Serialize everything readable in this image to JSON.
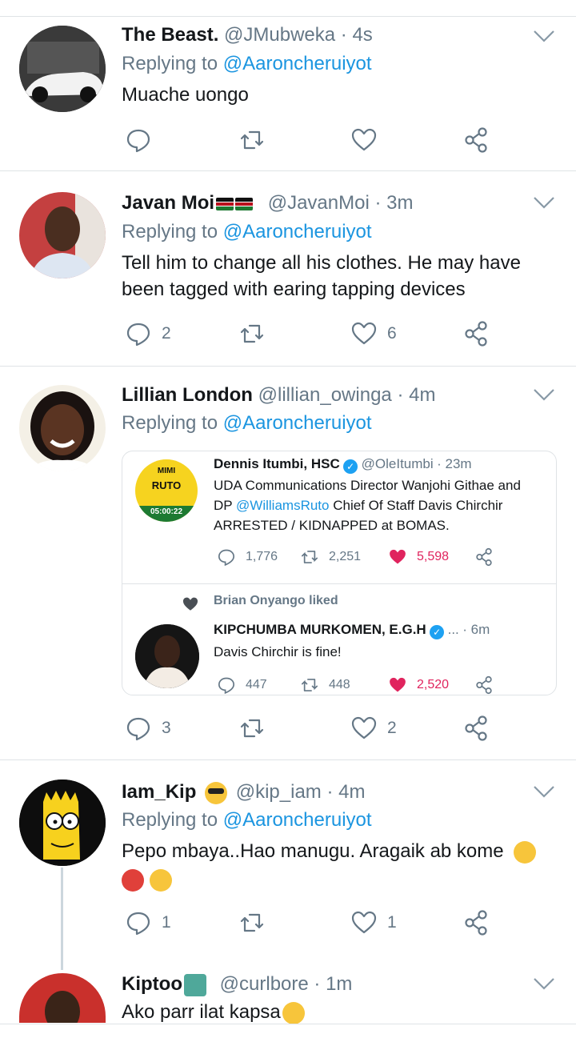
{
  "tweets": [
    {
      "name": "The Beast.",
      "handle": "@JMubweka",
      "time": "· 4s",
      "replying_prefix": "Replying to ",
      "replying_to": "@Aaroncheruiyot",
      "text": "Muache uongo",
      "replies": "",
      "likes": ""
    },
    {
      "name": "Javan Moi",
      "handle": "@JavanMoi",
      "time": "· 3m",
      "replying_prefix": "Replying to ",
      "replying_to": "@Aaroncheruiyot",
      "text": "Tell him to change all his clothes. He may have been tagged with earing tapping devices",
      "replies": "2",
      "likes": "6"
    },
    {
      "name": "Lillian London",
      "handle": "@lillian_owinga",
      "time": "· 4m",
      "replying_prefix": "Replying to ",
      "replying_to": "@Aaroncheruiyot",
      "text": "",
      "replies": "3",
      "likes": "2"
    },
    {
      "name": "Iam_Kip",
      "handle": "@kip_iam",
      "time": "· 4m",
      "replying_prefix": "Replying to ",
      "replying_to": "@Aaroncheruiyot",
      "text": "Pepo mbaya..Hao manugu. Aragaik ab kome",
      "replies": "1",
      "likes": "1"
    },
    {
      "name": "Kiptoo",
      "handle": "@curlbore",
      "time": "· 1m",
      "text": "Ako parr ilat kapsa"
    }
  ],
  "quoted": {
    "first": {
      "name": "Dennis Itumbi, HSC",
      "handle": "@OleItumbi",
      "time": "· 23m",
      "text_a": "UDA Communications Director Wanjohi Githae and DP ",
      "mention": "@WilliamsRuto",
      "text_b": " Chief Of Staff Davis Chirchir ARRESTED / KIDNAPPED at BOMAS.",
      "replies": "1,776",
      "retweets": "2,251",
      "likes": "5,598",
      "avatar_lines": [
        "MIMI",
        "RUTO",
        "05:00:22"
      ]
    },
    "liked_by": "Brian Onyango liked",
    "second": {
      "name": "KIPCHUMBA MURKOMEN, E.G.H",
      "ellipsis": "...",
      "time": "· 6m",
      "text": "Davis Chirchir is fine!",
      "replies": "447",
      "retweets": "448",
      "likes": "2,520"
    }
  },
  "colors": {
    "link": "#1b95e0",
    "muted": "#657786",
    "like_pink": "#e0245e",
    "separator": "#dfe3e6"
  },
  "icons": [
    "reply-icon",
    "retweet-icon",
    "like-icon",
    "share-icon",
    "chevron-down-icon",
    "verified-icon"
  ]
}
